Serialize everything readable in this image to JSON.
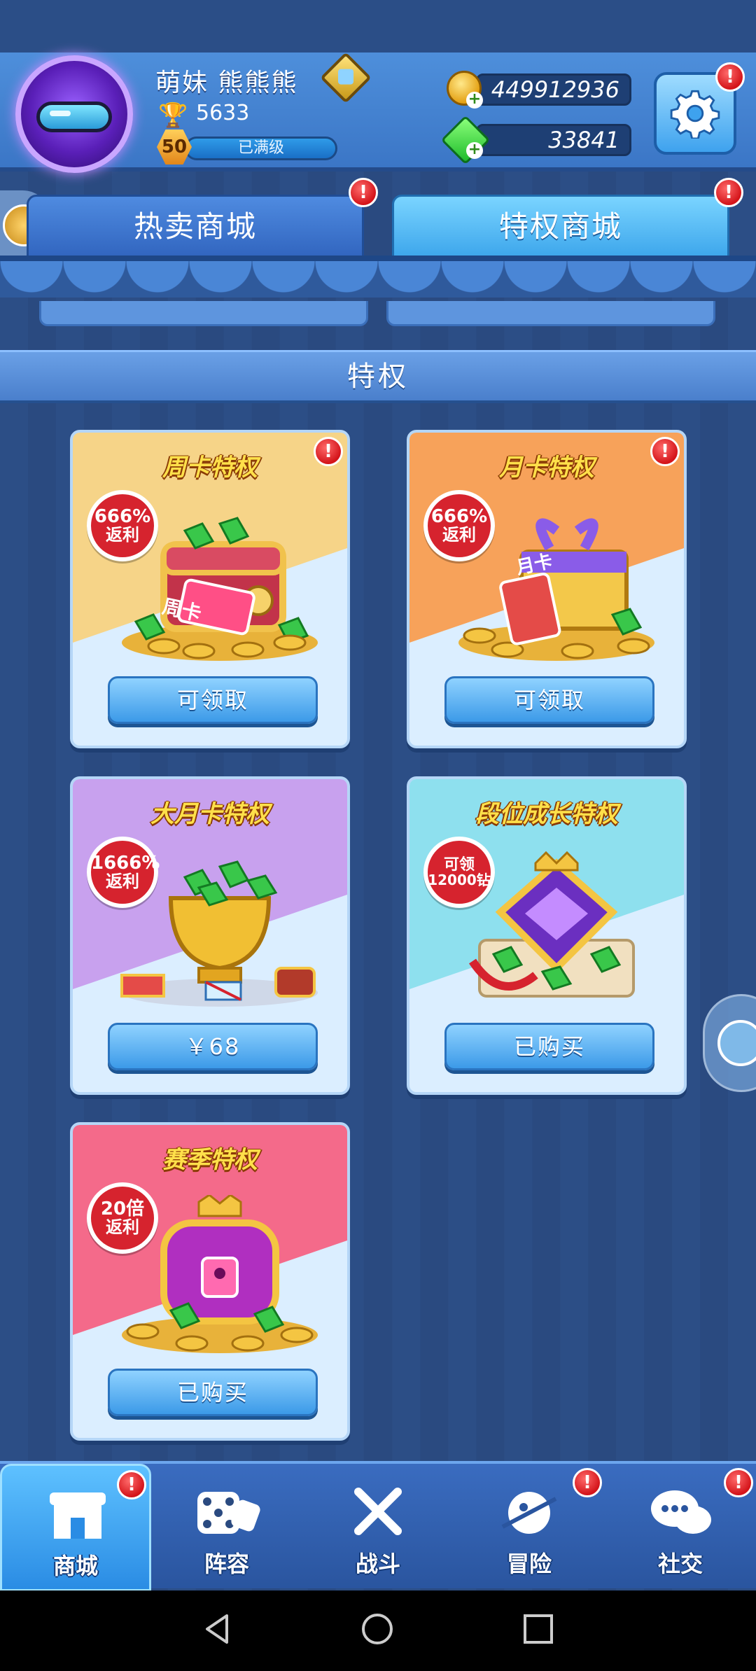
{
  "header": {
    "player_name": "萌妹  熊熊熊",
    "trophies": "5633",
    "level": "50",
    "level_status": "已满级",
    "coins": "449912936",
    "gems": "33841",
    "plus_symbol": "+",
    "alert_mark": "!"
  },
  "tabs": {
    "hot_store": "热卖商城",
    "privilege_store": "特权商城"
  },
  "section": {
    "title": "特权"
  },
  "cards": [
    {
      "title": "周卡特权",
      "badge_top": "666%",
      "badge_bottom": "返利",
      "art_label": "周卡",
      "button": "可领取",
      "accent": "#f6d488"
    },
    {
      "title": "月卡特权",
      "badge_top": "666%",
      "badge_bottom": "返利",
      "art_label": "月卡",
      "button": "可领取",
      "accent": "#f7a25a"
    },
    {
      "title": "大月卡特权",
      "badge_top": "1666%",
      "badge_bottom": "返利",
      "button": "￥68",
      "accent": "#c8a1ee"
    },
    {
      "title": "段位成长特权",
      "badge_top": "可领",
      "badge_bottom": "12000钻",
      "button": "已购买",
      "accent": "#8ee0ee"
    },
    {
      "title": "赛季特权",
      "badge_top": "20倍",
      "badge_bottom": "返利",
      "button": "已购买",
      "accent": "#f46a8a"
    }
  ],
  "nav": [
    {
      "label": "商城",
      "icon": "store-icon"
    },
    {
      "label": "阵容",
      "icon": "dice-icon"
    },
    {
      "label": "战斗",
      "icon": "crossed-swords-icon"
    },
    {
      "label": "冒险",
      "icon": "planet-icon"
    },
    {
      "label": "社交",
      "icon": "chat-bubbles-icon"
    }
  ]
}
